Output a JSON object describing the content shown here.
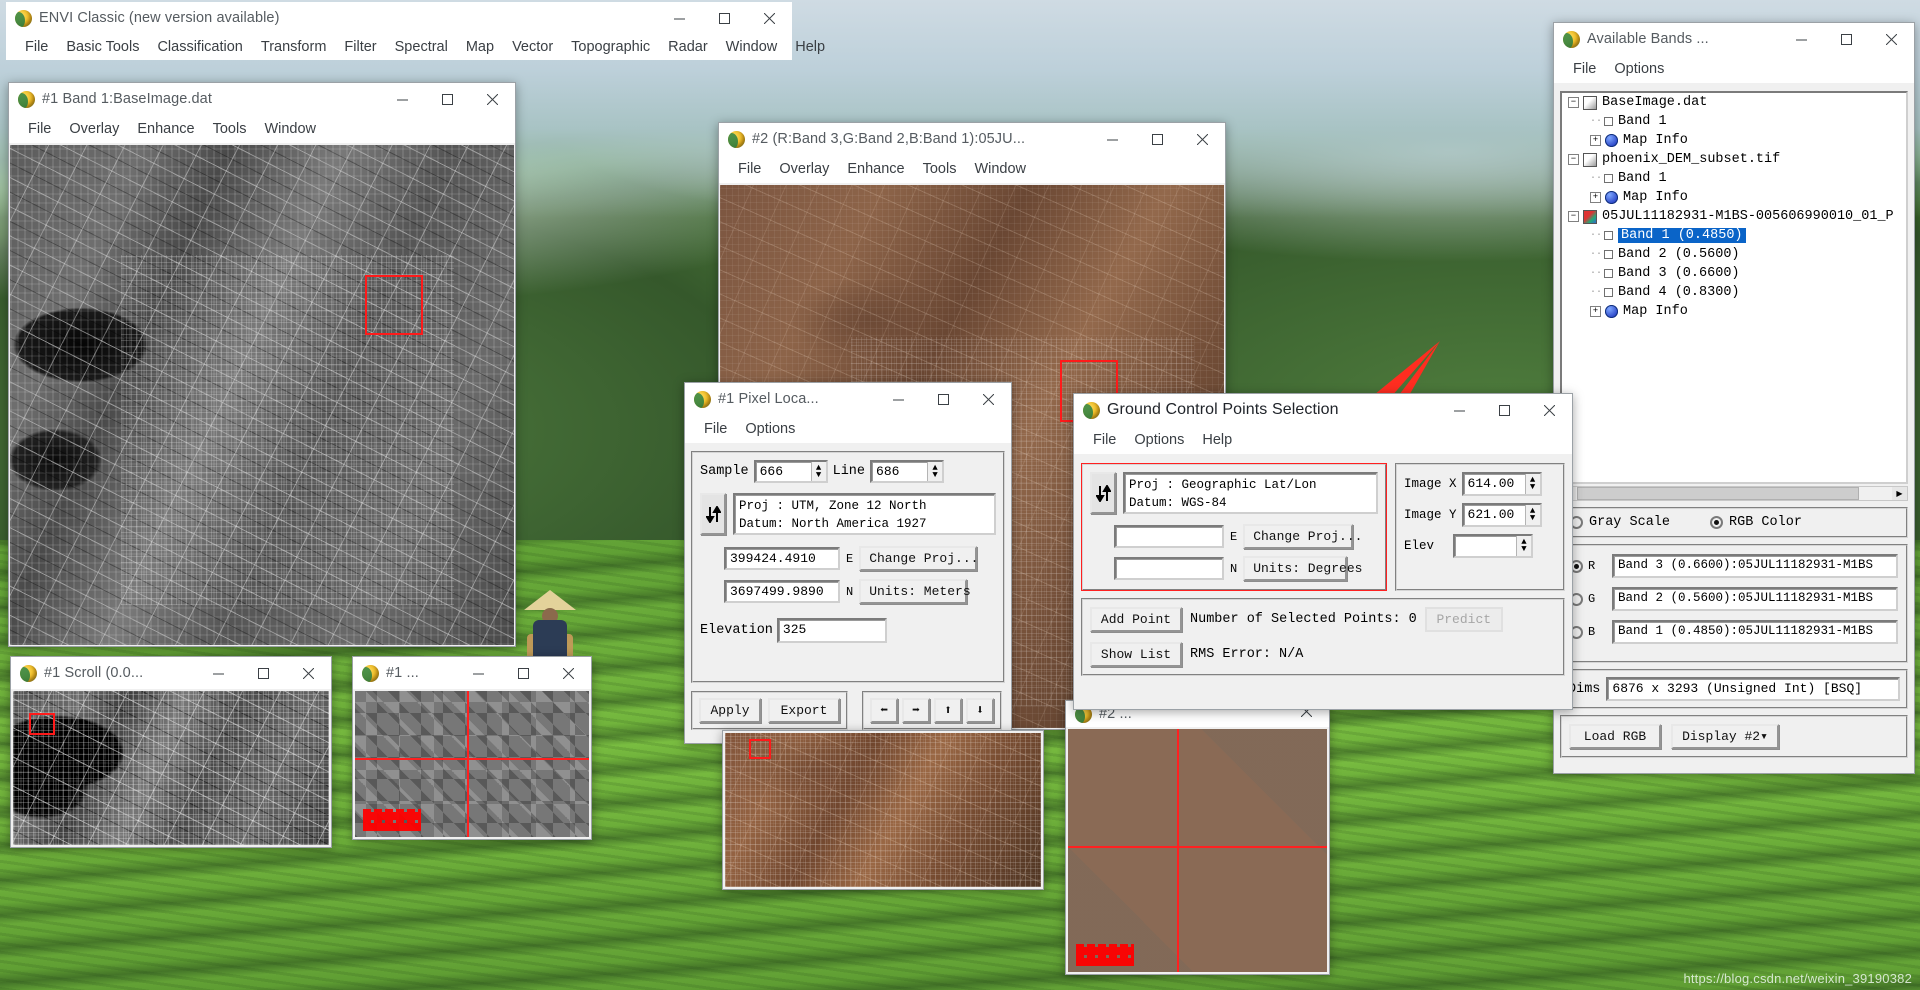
{
  "desktop": {
    "watermark": "https://blog.csdn.net/weixin_39190382"
  },
  "envi_main": {
    "title": "ENVI Classic (new version available)",
    "icon": "envi-globe-icon",
    "menu": [
      "File",
      "Basic Tools",
      "Classification",
      "Transform",
      "Filter",
      "Spectral",
      "Map",
      "Vector",
      "Topographic",
      "Radar",
      "Window",
      "Help"
    ],
    "buttons": {
      "minimize": "—",
      "maximize": "□",
      "close": "✕"
    }
  },
  "display1": {
    "title": "#1 Band 1:BaseImage.dat",
    "menu": [
      "File",
      "Overlay",
      "Enhance",
      "Tools",
      "Window"
    ]
  },
  "display2": {
    "title": "#2 (R:Band 3,G:Band 2,B:Band 1):05JU...",
    "menu": [
      "File",
      "Overlay",
      "Enhance",
      "Tools",
      "Window"
    ]
  },
  "scroll1": {
    "title": "#1 Scroll (0.0..."
  },
  "zoom1": {
    "title": "#1 ..."
  },
  "zoom2": {
    "title": "#2 ..."
  },
  "pixel_locator": {
    "title": "#1 Pixel Loca...",
    "menu": [
      "File",
      "Options"
    ],
    "sample_label": "Sample",
    "sample_value": "666",
    "line_label": "Line",
    "line_value": "686",
    "swap_icon": "up-down-arrows-icon",
    "proj_line1": "Proj : UTM, Zone 12 North",
    "proj_line2": "Datum: North America 1927",
    "easting_value": "399424.4910",
    "easting_suffix": "E",
    "northing_value": "3697499.9890",
    "northing_suffix": "N",
    "change_proj_label": "Change Proj...",
    "units_label": "Units: Meters",
    "elevation_label": "Elevation",
    "elevation_value": "325",
    "apply_label": "Apply",
    "export_label": "Export",
    "nav_icons": [
      "arrow-left-icon",
      "arrow-right-icon",
      "arrow-up-icon",
      "arrow-down-icon"
    ]
  },
  "gcp": {
    "title": "Ground Control Points Selection",
    "menu": [
      "File",
      "Options",
      "Help"
    ],
    "swap_icon": "up-down-arrows-icon",
    "proj_line1": "Proj : Geographic Lat/Lon",
    "proj_line2": "Datum: WGS-84",
    "east_value": "",
    "east_suffix": "E",
    "north_value": "",
    "north_suffix": "N",
    "change_proj_label": "Change Proj...",
    "units_label": "Units: Degrees",
    "image_x_label": "Image X",
    "image_x_value": "614.00",
    "image_y_label": "Image Y",
    "image_y_value": "621.00",
    "elev_label": "Elev",
    "elev_value": "",
    "add_point_label": "Add Point",
    "num_points_label": "Number of Selected Points:",
    "num_points_value": "0",
    "predict_label": "Predict",
    "show_list_label": "Show List",
    "rms_label": "RMS Error:",
    "rms_value": "N/A"
  },
  "available_bands": {
    "title": "Available Bands ...",
    "menu": [
      "File",
      "Options"
    ],
    "tree": [
      {
        "level": 0,
        "type": "file",
        "expander": "−",
        "label": "BaseImage.dat"
      },
      {
        "level": 1,
        "type": "band",
        "label": "Band 1"
      },
      {
        "level": 1,
        "type": "mapinfo",
        "expander": "+",
        "label": "Map Info"
      },
      {
        "level": 0,
        "type": "file",
        "expander": "−",
        "label": "phoenix_DEM_subset.tif"
      },
      {
        "level": 1,
        "type": "band",
        "label": "Band 1"
      },
      {
        "level": 1,
        "type": "mapinfo",
        "expander": "+",
        "label": "Map Info"
      },
      {
        "level": 0,
        "type": "cube",
        "expander": "−",
        "label": "05JUL11182931-M1BS-005606990010_01_P"
      },
      {
        "level": 1,
        "type": "band",
        "label": "Band 1 (0.4850)",
        "selected": true
      },
      {
        "level": 1,
        "type": "band",
        "label": "Band 2 (0.5600)"
      },
      {
        "level": 1,
        "type": "band",
        "label": "Band 3 (0.6600)"
      },
      {
        "level": 1,
        "type": "band",
        "label": "Band 4 (0.8300)"
      },
      {
        "level": 1,
        "type": "mapinfo",
        "expander": "+",
        "label": "Map Info"
      }
    ],
    "mode_gray_label": "Gray Scale",
    "mode_rgb_label": "RGB Color",
    "mode_selected": "RGB Color",
    "channels": [
      {
        "key": "R",
        "selected": true,
        "value": "Band 3 (0.6600):05JUL11182931-M1BS"
      },
      {
        "key": "G",
        "selected": false,
        "value": "Band 2 (0.5600):05JUL11182931-M1BS"
      },
      {
        "key": "B",
        "selected": false,
        "value": "Band 1 (0.4850):05JUL11182931-M1BS"
      }
    ],
    "dims_label": "Dims",
    "dims_value": "6876 x 3293 (Unsigned Int) [BSQ]",
    "load_rgb_label": "Load RGB",
    "display_label": "Display #2▾"
  }
}
